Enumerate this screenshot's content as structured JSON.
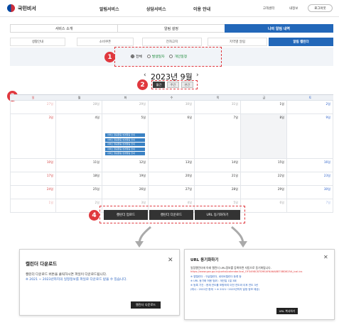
{
  "header": {
    "logo_text": "국민비서",
    "nav": [
      "알림서비스",
      "상담서비스",
      "이용 안내"
    ],
    "utils": [
      "고객센터",
      "내정보"
    ],
    "login_label": "로그아웃"
  },
  "tabs_main": [
    {
      "label": "서비스 소개",
      "active": false
    },
    {
      "label": "알림 설정",
      "active": false
    },
    {
      "label": "나의 알림 내역",
      "active": true
    }
  ],
  "tabs_sub": [
    {
      "label": "생활안내",
      "active": false
    },
    {
      "label": "소비쿠폰",
      "active": false
    },
    {
      "label": "전자고지",
      "active": false
    },
    {
      "label": "지역별 알림",
      "active": false
    },
    {
      "label": "알림 캘린더",
      "active": true
    }
  ],
  "badges": [
    "1",
    "2",
    "3",
    "4"
  ],
  "filter": {
    "options": [
      {
        "label": "전체",
        "checked": true
      },
      {
        "label": "발생일자",
        "checked": false
      },
      {
        "label": "개인일정",
        "checked": false
      }
    ]
  },
  "month": {
    "title": "2023년 9월",
    "prev": "‹",
    "next": "›",
    "views": [
      {
        "label": "월간",
        "active": true
      },
      {
        "label": "주간",
        "active": false
      },
      {
        "label": "연간",
        "active": false
      }
    ]
  },
  "calendar": {
    "weekdays": [
      "일",
      "월",
      "화",
      "수",
      "목",
      "금",
      "토"
    ],
    "weeks": [
      [
        "27일",
        "28일",
        "29일",
        "30일",
        "31일",
        "1일",
        "2일"
      ],
      [
        "3일",
        "4일",
        "5일",
        "6일",
        "7일",
        "8일",
        "9일"
      ],
      [
        "10일",
        "11일",
        "12일",
        "13일",
        "14일",
        "15일",
        "16일"
      ],
      [
        "17일",
        "18일",
        "19일",
        "20일",
        "21일",
        "22일",
        "23일"
      ],
      [
        "24일",
        "25일",
        "26일",
        "27일",
        "28일",
        "29일",
        "30일"
      ],
      [
        "1일",
        "2일",
        "3일",
        "4일",
        "5일",
        "6일",
        "7일"
      ]
    ],
    "events": [
      "서비스 알림알림 변경알림 안내",
      "서비스 알림알림 변경알림 안내",
      "서비스 알림알림 변경알림 안내",
      "서비스 알림알림 변경알림 안내",
      "서비스 알림알림 변경알림 안내"
    ]
  },
  "actions": [
    "캘린더 업로드",
    "캘린더 다운로드",
    "URL 동기화하기"
  ],
  "modal_download": {
    "title": "캘린더 다운로드",
    "close": "✕",
    "line1": "캘린더 다운로드 버튼을 클릭하시면 파일이 다운로드됩니다.",
    "line2": "※ 2021 ~ 2023년까지의 일정정보를 파일로 다운로드 받을 수 있습니다.",
    "button": "캘린더 다운로드"
  },
  "modal_url": {
    "title": "URL 동기화하기",
    "close": "✕",
    "line1": "일정캘린더에 아래 캘린더 URL정보를 등록하면 자동으로 동기화됩니다.",
    "url": "https://www.gov.go.kr/portal/calendar/ical_OF3498CB7D9EAF6A6A8B70BD625A_ical.ics",
    "line3": "※ 앱캘린더 : 구글캘린더, 네이버캘린더 등록 등",
    "line4": "※ URL 동기화 허용 범위 : 개인일 1일 3회",
    "line5": "※ 등록 기간 : 현재 연도를 포함하여 이전 연도와 이후 연도 3년",
    "line6": "(예시 : 2022년 현재 → ※ 2021~2023년까지 일정 정보 제공)",
    "button": "URL 복사하기"
  }
}
